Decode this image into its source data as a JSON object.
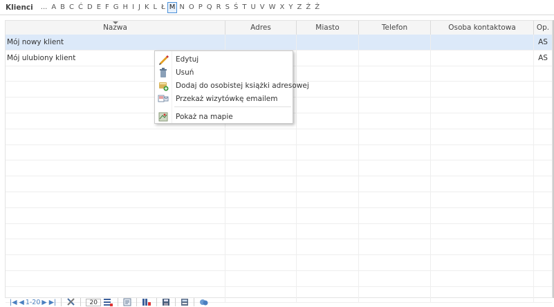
{
  "header": {
    "title": "Klienci",
    "letters": [
      "...",
      "A",
      "B",
      "C",
      "Ć",
      "D",
      "E",
      "F",
      "G",
      "H",
      "I",
      "J",
      "K",
      "L",
      "Ł",
      "M",
      "N",
      "O",
      "P",
      "Q",
      "R",
      "S",
      "Ś",
      "T",
      "U",
      "V",
      "W",
      "X",
      "Y",
      "Z",
      "Ź",
      "Ż"
    ],
    "active_letter": "M"
  },
  "table": {
    "columns": [
      "Nazwa",
      "Adres",
      "Miasto",
      "Telefon",
      "Osoba kontaktowa",
      "Op."
    ],
    "rows": [
      {
        "nazwa": "Mój nowy klient",
        "adres": "",
        "miasto": "",
        "telefon": "",
        "osoba": "",
        "op": "AS",
        "selected": true
      },
      {
        "nazwa": "Mój ulubiony klient",
        "adres": "",
        "miasto": "",
        "telefon": "",
        "osoba": "",
        "op": "AS",
        "selected": false
      }
    ]
  },
  "context_menu": {
    "items": [
      {
        "label": "Edytuj",
        "icon": "pencil-icon"
      },
      {
        "label": "Usuń",
        "icon": "trash-icon"
      },
      {
        "label": "Dodaj do osobistej książki adresowej",
        "icon": "address-book-add-icon"
      },
      {
        "label": "Przekaż wizytówkę emailem",
        "icon": "business-card-email-icon"
      },
      {
        "label": "Pokaż na mapie",
        "icon": "map-icon"
      }
    ]
  },
  "toolbar": {
    "pager_range": "1-20",
    "page_size": "20",
    "icons": [
      "first-page-icon",
      "prev-page-icon",
      "next-page-icon",
      "last-page-icon",
      "tools-icon",
      "page-size-icon",
      "export-icon",
      "columns-icon",
      "save-icon",
      "calculator-icon",
      "refresh-icon"
    ]
  },
  "colors": {
    "selected_row": "#dce9f9",
    "accent": "#4a90d9",
    "pager": "#4a7fc0"
  }
}
